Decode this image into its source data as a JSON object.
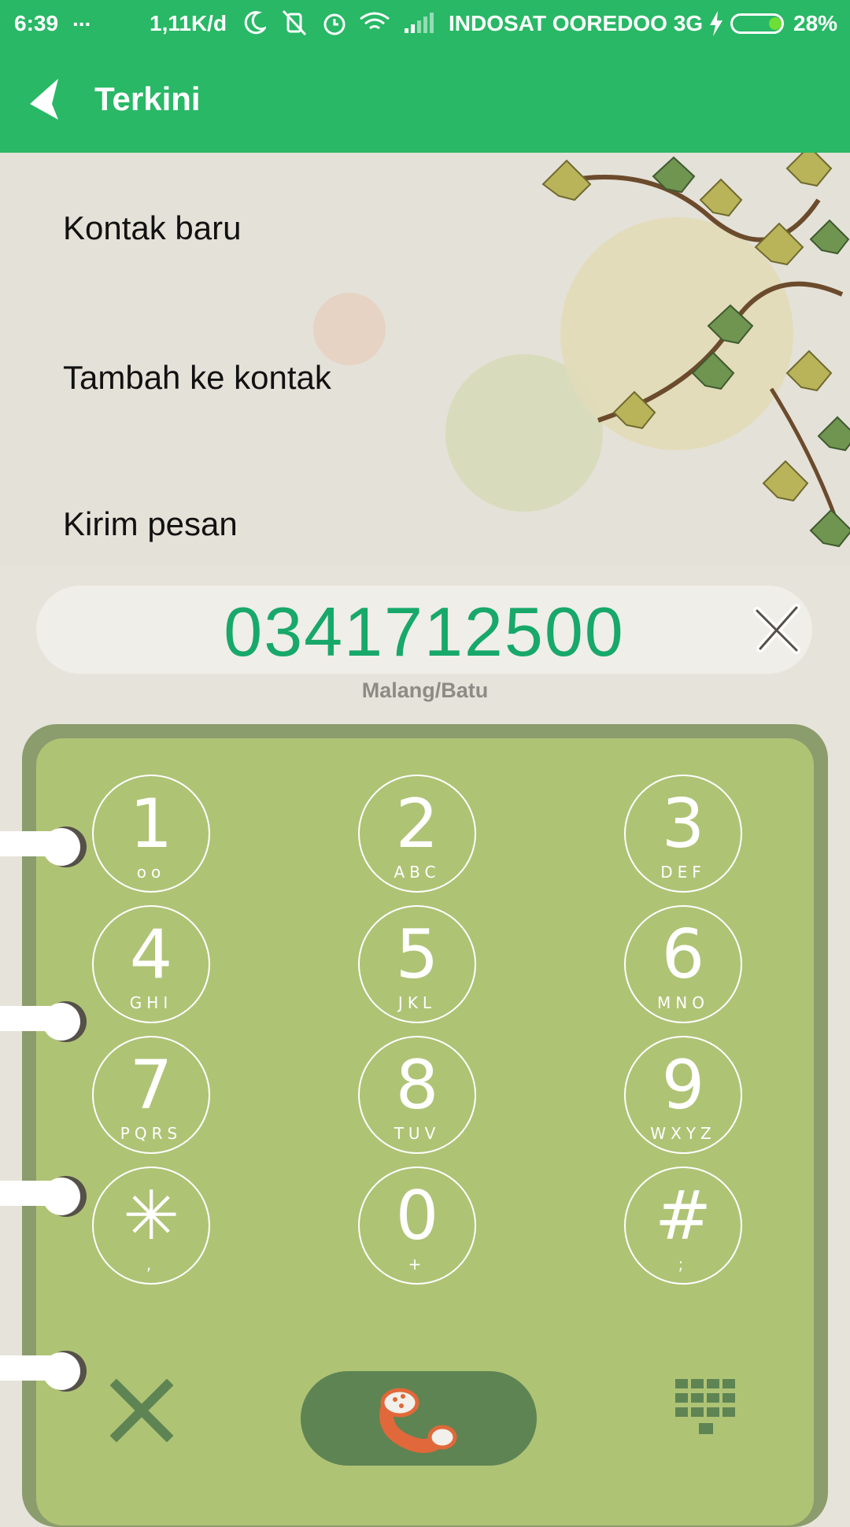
{
  "status_bar": {
    "time": "6:39",
    "dots": "...",
    "speed": "1,11K/d",
    "carrier": "INDOSAT OOREDOO 3G",
    "battery": "28%"
  },
  "app_bar": {
    "title": "Terkini"
  },
  "menu": {
    "items": [
      "Kontak baru",
      "Tambah ke kontak",
      "Kirim pesan"
    ]
  },
  "dialer": {
    "number": "0341712500",
    "location": "Malang/Batu"
  },
  "keypad": {
    "keys": [
      {
        "digit": "1",
        "letters": "oo"
      },
      {
        "digit": "2",
        "letters": "ABC"
      },
      {
        "digit": "3",
        "letters": "DEF"
      },
      {
        "digit": "4",
        "letters": "GHI"
      },
      {
        "digit": "5",
        "letters": "JKL"
      },
      {
        "digit": "6",
        "letters": "MNO"
      },
      {
        "digit": "7",
        "letters": "PQRS"
      },
      {
        "digit": "8",
        "letters": "TUV"
      },
      {
        "digit": "9",
        "letters": "WXYZ"
      },
      {
        "digit": "✳",
        "letters": ","
      },
      {
        "digit": "0",
        "letters": "+"
      },
      {
        "digit": "#",
        "letters": ";"
      }
    ]
  },
  "colors": {
    "accent": "#29b866",
    "number": "#17a86a",
    "keypad_bg": "#afc375",
    "call_button": "#5e8453",
    "call_icon": "#e0683a"
  },
  "icons": {
    "back": "back-arrow-icon",
    "clear": "close-icon",
    "call": "phone-handset-icon",
    "hide_keypad": "dialpad-grid-icon",
    "delete": "close-icon"
  }
}
